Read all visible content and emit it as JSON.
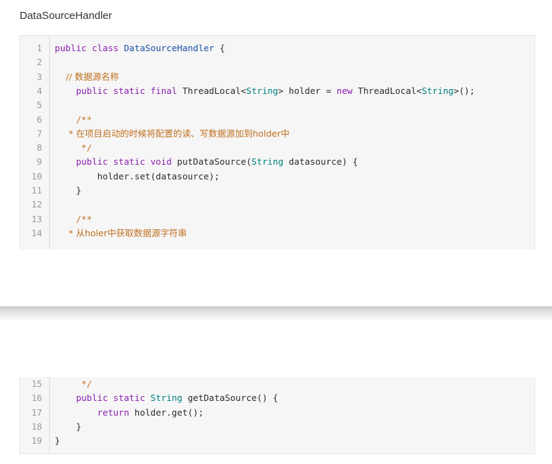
{
  "file_title": "DataSourceHandler",
  "code_lines": [
    {
      "n": "1",
      "tokens": [
        {
          "t": "public class ",
          "c": "kw"
        },
        {
          "t": "DataSourceHandler",
          "c": "cls"
        },
        {
          "t": " {",
          "c": ""
        }
      ]
    },
    {
      "n": "2",
      "tokens": []
    },
    {
      "n": "3",
      "tokens": [
        {
          "t": "    // 数据源名称",
          "c": "cm"
        }
      ]
    },
    {
      "n": "4",
      "tokens": [
        {
          "t": "    public static final ",
          "c": "kw"
        },
        {
          "t": "ThreadLocal<",
          "c": ""
        },
        {
          "t": "String",
          "c": "type"
        },
        {
          "t": "> holder = ",
          "c": ""
        },
        {
          "t": "new ",
          "c": "kw"
        },
        {
          "t": "ThreadLocal<",
          "c": ""
        },
        {
          "t": "String",
          "c": "type"
        },
        {
          "t": ">();",
          "c": ""
        }
      ]
    },
    {
      "n": "5",
      "tokens": []
    },
    {
      "n": "6",
      "tokens": [
        {
          "t": "    /**",
          "c": "cm"
        }
      ]
    },
    {
      "n": "7",
      "tokens": [
        {
          "t": "     * 在项目启动的时候将配置的读、写数据源加到holder中",
          "c": "cm"
        }
      ]
    },
    {
      "n": "8",
      "tokens": [
        {
          "t": "     */",
          "c": "cm"
        }
      ]
    },
    {
      "n": "9",
      "tokens": [
        {
          "t": "    public static void ",
          "c": "kw"
        },
        {
          "t": "putDataSource(",
          "c": ""
        },
        {
          "t": "String",
          "c": "type"
        },
        {
          "t": " datasource) {",
          "c": ""
        }
      ]
    },
    {
      "n": "10",
      "tokens": [
        {
          "t": "        holder.set(datasource);",
          "c": ""
        }
      ]
    },
    {
      "n": "11",
      "tokens": [
        {
          "t": "    }",
          "c": ""
        }
      ]
    },
    {
      "n": "12",
      "tokens": []
    },
    {
      "n": "13",
      "tokens": [
        {
          "t": "    /**",
          "c": "cm"
        }
      ]
    },
    {
      "n": "14",
      "tokens": [
        {
          "t": "     * 从holer中获取数据源字符串",
          "c": "cm"
        }
      ]
    },
    {
      "n": "15",
      "tokens": [
        {
          "t": "     */",
          "c": "cm"
        }
      ]
    },
    {
      "n": "16",
      "tokens": [
        {
          "t": "    public static ",
          "c": "kw"
        },
        {
          "t": "String",
          "c": "type"
        },
        {
          "t": " getDataSource() {",
          "c": ""
        }
      ]
    },
    {
      "n": "17",
      "tokens": [
        {
          "t": "        return ",
          "c": "kw"
        },
        {
          "t": "holder.get();",
          "c": ""
        }
      ]
    },
    {
      "n": "18",
      "tokens": [
        {
          "t": "    }",
          "c": ""
        }
      ]
    },
    {
      "n": "19",
      "tokens": [
        {
          "t": "}",
          "c": ""
        }
      ]
    }
  ]
}
